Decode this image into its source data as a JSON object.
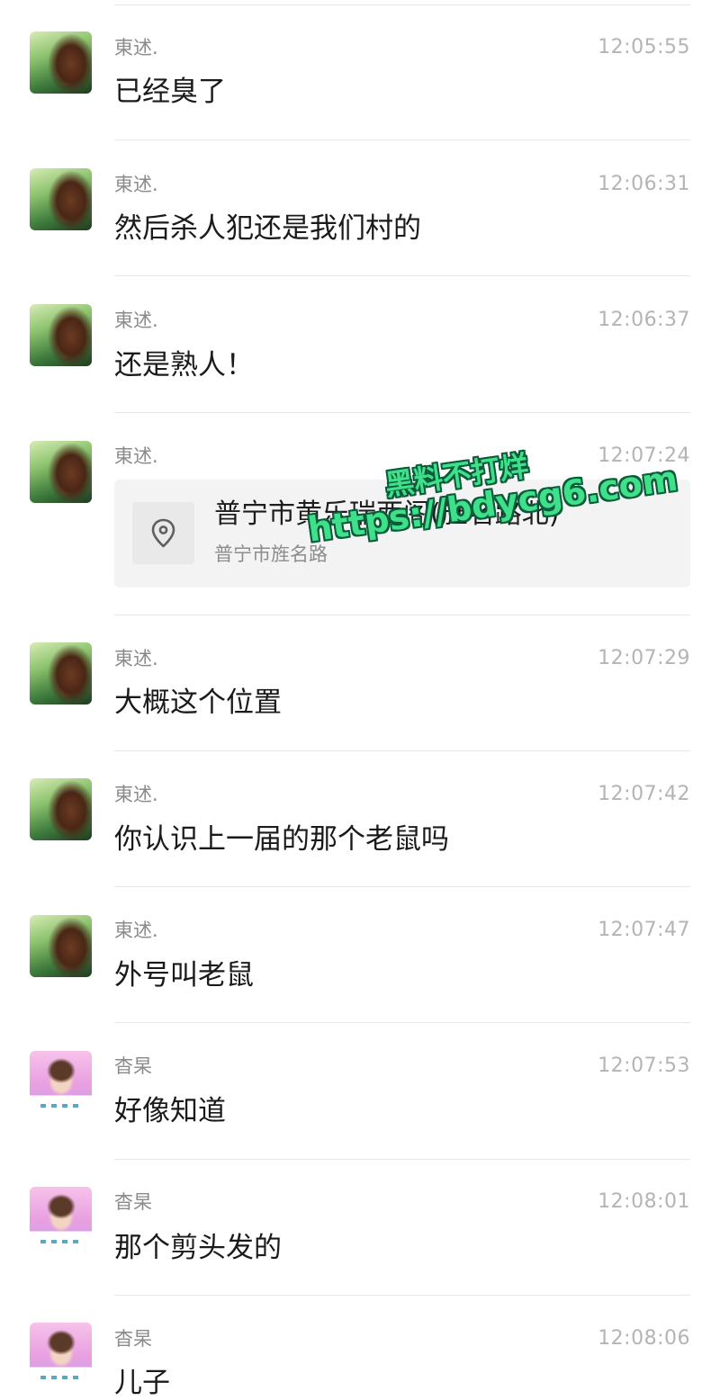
{
  "messages": [
    {
      "sender": "東述.",
      "time": "12:05:55",
      "text": "已经臭了"
    },
    {
      "sender": "東述.",
      "time": "12:06:31",
      "text": "然后杀人犯还是我们村的"
    },
    {
      "sender": "東述.",
      "time": "12:06:37",
      "text": "还是熟人！"
    },
    {
      "sender": "東述.",
      "time": "12:07:24",
      "location_title": "普宁市黄乐瑞西阁(旌名路北)",
      "location_subtitle": "普宁市旌名路"
    },
    {
      "sender": "東述.",
      "time": "12:07:29",
      "text": "大概这个位置"
    },
    {
      "sender": "東述.",
      "time": "12:07:42",
      "text": "你认识上一届的那个老鼠吗"
    },
    {
      "sender": "東述.",
      "time": "12:07:47",
      "text": "外号叫老鼠"
    },
    {
      "sender": "杳杲",
      "time": "12:07:53",
      "text": "好像知道"
    },
    {
      "sender": "杳杲",
      "time": "12:08:01",
      "text": "那个剪头发的"
    },
    {
      "sender": "杳杲",
      "time": "12:08:06",
      "text": "儿子"
    }
  ],
  "watermark": {
    "line1": "黑料不打烊",
    "line2": "https://bdycg6.com"
  },
  "icons": {
    "location": "map-pin-icon"
  }
}
